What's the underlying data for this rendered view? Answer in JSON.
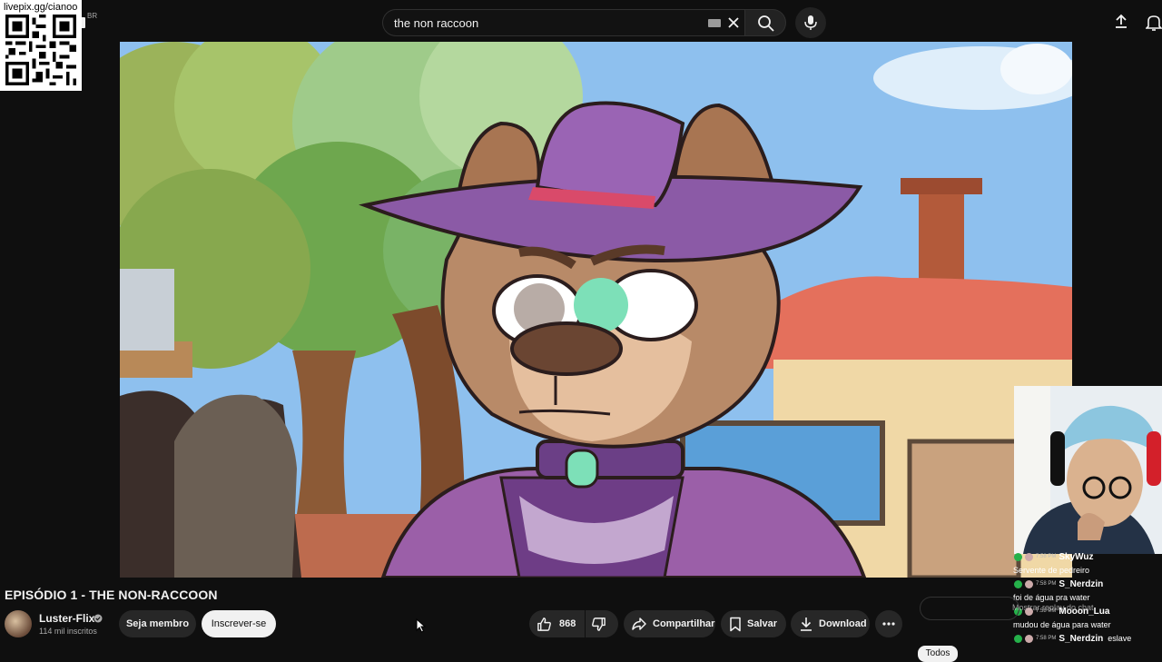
{
  "header": {
    "country_code": "BR",
    "search": {
      "query": "the non raccoon"
    }
  },
  "overlay": {
    "qr_url": "livepix.gg/cianoo"
  },
  "video": {
    "title": "EPISÓDIO 1 - THE NON-RACCOON"
  },
  "channel": {
    "name": "Luster-Flix",
    "subscribers": "114 mil inscritos",
    "member_label": "Seja membro",
    "subscribe_label": "Inscrever-se"
  },
  "actions": {
    "like_count": "868",
    "share_label": "Compartilhar",
    "save_label": "Salvar",
    "download_label": "Download"
  },
  "chat": {
    "messages": [
      {
        "time": "7:58 PM",
        "user": "SkyWuz",
        "text": "Servente de pedreiro"
      },
      {
        "time": "7:58 PM",
        "user": "S_Nerdzin",
        "text": "foi de água pra water"
      },
      {
        "time": "7:58 PM",
        "user": "Mooon_Lua",
        "text": "mudou de água para water"
      },
      {
        "time": "7:58 PM",
        "user": "S_Nerdzin",
        "text": "eslave"
      }
    ],
    "overlay_text": "Mostrar replay do chat"
  },
  "filters": {
    "active_chip": "Todos"
  },
  "colors": {
    "background": "#0f0f0f",
    "pill": "#272727",
    "subscribe_bg": "#f1f1f1",
    "chat_badge": "#25b14a"
  }
}
